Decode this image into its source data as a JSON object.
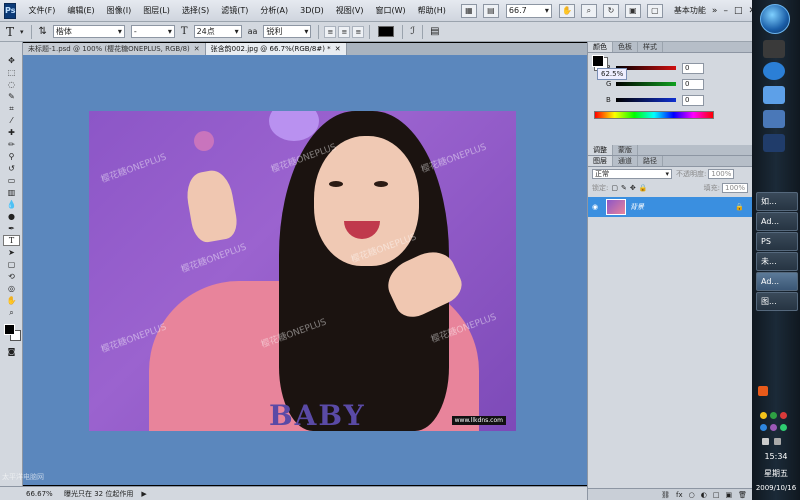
{
  "app": {
    "logo": "Ps"
  },
  "menu": [
    "文件(F)",
    "编辑(E)",
    "图像(I)",
    "图层(L)",
    "选择(S)",
    "滤镜(T)",
    "分析(A)",
    "3D(D)",
    "视图(V)",
    "窗口(W)",
    "帮助(H)"
  ],
  "menubar_right": {
    "zoom": "66.7",
    "workspace": "基本功能",
    "minimize": "–",
    "restore": "□",
    "close": "✕"
  },
  "options": {
    "tool_icon": "T",
    "font_family": "楷体",
    "font_style": "-",
    "font_size": "24点",
    "antialias_label": "aa",
    "antialias": "锐利",
    "text_color": "#000000"
  },
  "tabs": [
    {
      "label": "未标题-1.psd @ 100% (樱花糖ONEPLUS, RGB/8)",
      "active": false
    },
    {
      "label": "张含韵002.jpg @ 66.7%(RGB/8#) *",
      "active": true
    }
  ],
  "photo": {
    "title_text": "BABY",
    "watermark": "樱花糖ONEPLUS",
    "corner_tag": "www.llkdns.com"
  },
  "status": {
    "zoom": "66.67%",
    "message": "曝光只在 32 位起作用",
    "arrow": "▶"
  },
  "color_panel": {
    "tabs": [
      "颜色",
      "色板",
      "样式"
    ],
    "tooltip": "62.5%",
    "rows": [
      {
        "label": "R",
        "value": "0",
        "color": "#d01010"
      },
      {
        "label": "G",
        "value": "0",
        "color": "#10a020"
      },
      {
        "label": "B",
        "value": "0",
        "color": "#1030d0"
      }
    ]
  },
  "adjust_panel": {
    "tabs": [
      "调整",
      "蒙版"
    ]
  },
  "layers_panel": {
    "tabs": [
      "图层",
      "通道",
      "路径"
    ],
    "blend_mode": "正常",
    "opacity_label": "不透明度:",
    "opacity": "100%",
    "lock_label": "锁定:",
    "fill_label": "填充:",
    "fill": "100%",
    "layers": [
      {
        "name": "背景",
        "locked": true
      }
    ],
    "bottom_icons": [
      "fx",
      "○",
      "◐",
      "□",
      "▣",
      "🗑"
    ]
  },
  "taskbar": {
    "buttons": [
      {
        "label": "如...",
        "active": false
      },
      {
        "label": "Ad...",
        "active": false
      },
      {
        "label": "PS",
        "active": false
      },
      {
        "label": "未...",
        "active": false
      },
      {
        "label": "Ad...",
        "active": true
      },
      {
        "label": "图...",
        "active": false
      }
    ],
    "time": "15:34",
    "weekday": "星期五",
    "date": "2009/10/16"
  },
  "site_watermark": "太平洋电脑网"
}
